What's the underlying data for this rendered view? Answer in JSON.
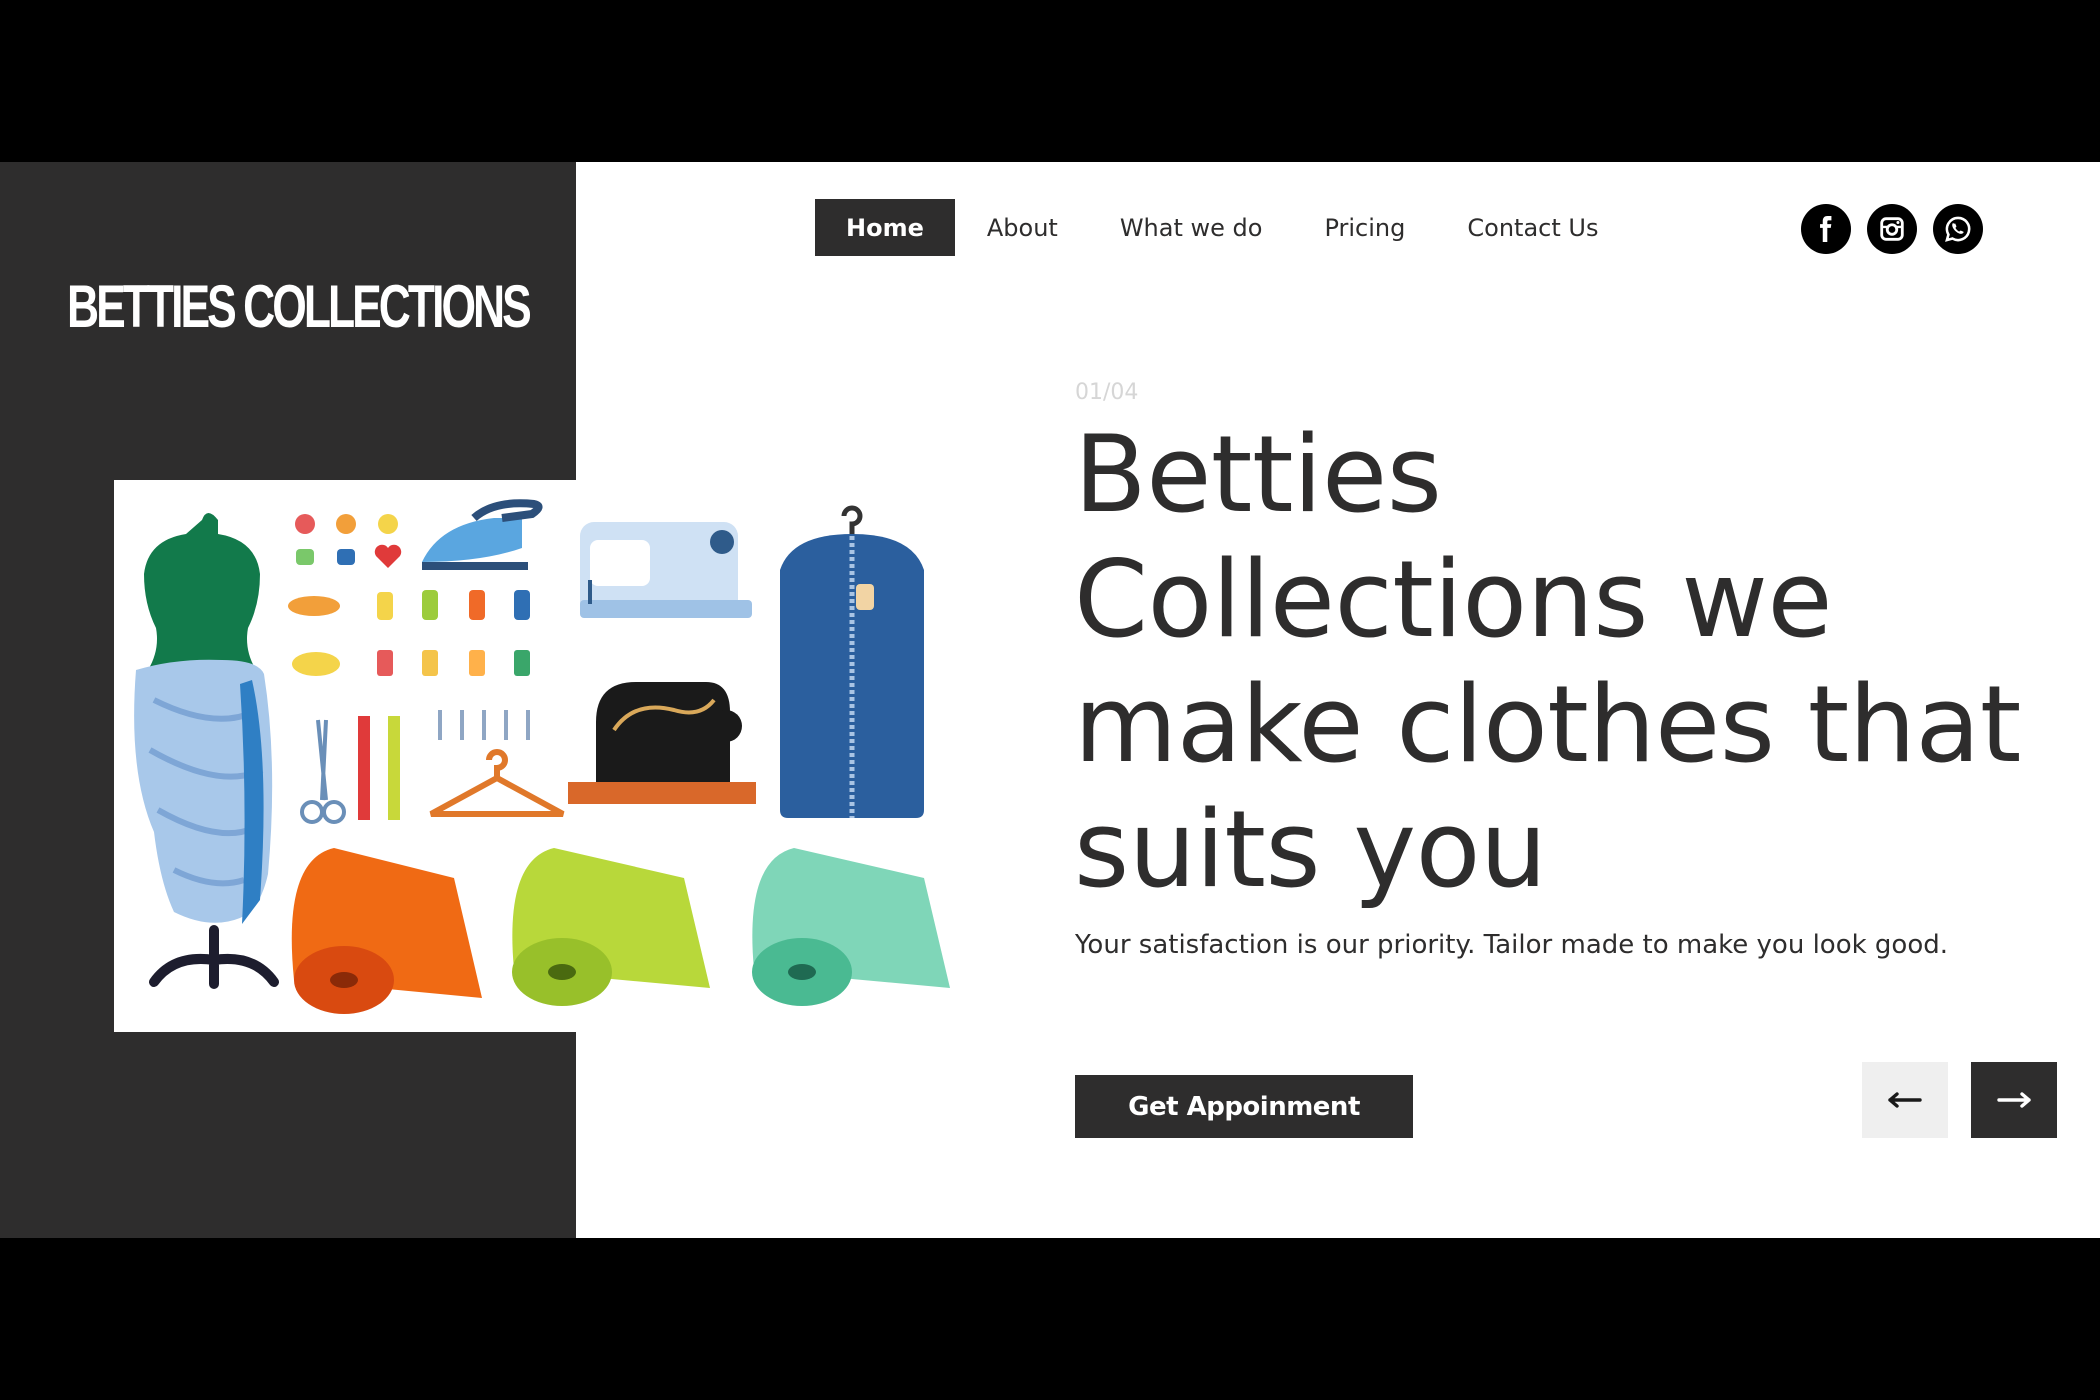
{
  "brand": {
    "logo_text": "BETTIES COLLECTIONS"
  },
  "nav": {
    "items": [
      {
        "label": "Home",
        "active": true
      },
      {
        "label": "About"
      },
      {
        "label": "What we do"
      },
      {
        "label": "Pricing"
      },
      {
        "label": "Contact Us"
      }
    ]
  },
  "social": {
    "icons": [
      "facebook-icon",
      "instagram-icon",
      "whatsapp-icon"
    ]
  },
  "hero": {
    "counter": "01/04",
    "headline": "Betties Collections we make clothes that suits you",
    "subtext": "Your satisfaction is our priority. Tailor made to make you look good.",
    "cta_label": "Get Appoinment"
  },
  "slider": {
    "prev_icon": "arrow-left-icon",
    "next_icon": "arrow-right-icon"
  },
  "colors": {
    "dark": "#2e2d2d",
    "page_bg": "#ffffff",
    "letterbox": "#000000",
    "counter": "#d6d6d6",
    "prev_button_bg": "#efefef"
  }
}
